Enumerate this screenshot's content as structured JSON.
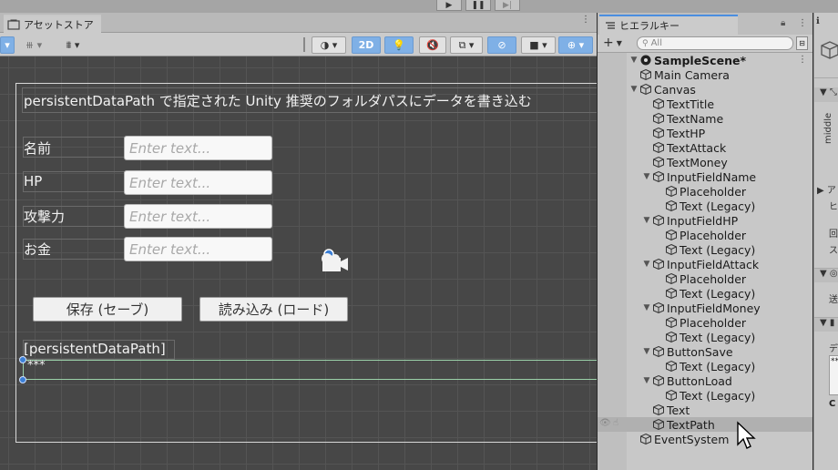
{
  "toolbar_play": {
    "play": "▶",
    "pause": "❚❚",
    "step": "▶|"
  },
  "scene": {
    "tab_label": "アセットストア",
    "toolbar": {
      "mode_2d": "2D"
    }
  },
  "game_ui": {
    "title": "persistentDataPath で指定された Unity 推奨のフォルダパスにデータを書き込む",
    "fields": [
      {
        "label": "名前",
        "placeholder": "Enter text..."
      },
      {
        "label": "HP",
        "placeholder": "Enter text..."
      },
      {
        "label": "攻撃力",
        "placeholder": "Enter text..."
      },
      {
        "label": "お金",
        "placeholder": "Enter text..."
      }
    ],
    "save_button": "保存 (セーブ)",
    "load_button": "読み込み (ロード)",
    "path_label": "[persistentDataPath]",
    "path_value": "***"
  },
  "hierarchy": {
    "tab_label": "ヒエラルキー",
    "search_placeholder": "All",
    "add_label": "+",
    "scene_name": "SampleScene*",
    "items": [
      {
        "name": "Main Camera",
        "depth": 1,
        "expandable": false
      },
      {
        "name": "Canvas",
        "depth": 1,
        "expandable": true
      },
      {
        "name": "TextTitle",
        "depth": 2,
        "expandable": false
      },
      {
        "name": "TextName",
        "depth": 2,
        "expandable": false
      },
      {
        "name": "TextHP",
        "depth": 2,
        "expandable": false
      },
      {
        "name": "TextAttack",
        "depth": 2,
        "expandable": false
      },
      {
        "name": "TextMoney",
        "depth": 2,
        "expandable": false
      },
      {
        "name": "InputFieldName",
        "depth": 2,
        "expandable": true
      },
      {
        "name": "Placeholder",
        "depth": 3,
        "expandable": false
      },
      {
        "name": "Text (Legacy)",
        "depth": 3,
        "expandable": false
      },
      {
        "name": "InputFieldHP",
        "depth": 2,
        "expandable": true
      },
      {
        "name": "Placeholder",
        "depth": 3,
        "expandable": false
      },
      {
        "name": "Text (Legacy)",
        "depth": 3,
        "expandable": false
      },
      {
        "name": "InputFieldAttack",
        "depth": 2,
        "expandable": true
      },
      {
        "name": "Placeholder",
        "depth": 3,
        "expandable": false
      },
      {
        "name": "Text (Legacy)",
        "depth": 3,
        "expandable": false
      },
      {
        "name": "InputFieldMoney",
        "depth": 2,
        "expandable": true
      },
      {
        "name": "Placeholder",
        "depth": 3,
        "expandable": false
      },
      {
        "name": "Text (Legacy)",
        "depth": 3,
        "expandable": false
      },
      {
        "name": "ButtonSave",
        "depth": 2,
        "expandable": true
      },
      {
        "name": "Text (Legacy)",
        "depth": 3,
        "expandable": false
      },
      {
        "name": "ButtonLoad",
        "depth": 2,
        "expandable": true
      },
      {
        "name": "Text (Legacy)",
        "depth": 3,
        "expandable": false
      },
      {
        "name": "Text",
        "depth": 2,
        "expandable": false
      },
      {
        "name": "TextPath",
        "depth": 2,
        "expandable": false,
        "selected": true
      },
      {
        "name": "EventSystem",
        "depth": 1,
        "expandable": false
      }
    ]
  },
  "inspector": {
    "anchor_label": "middle",
    "section_chars": [
      "ア",
      "ヒ",
      "回",
      "ス",
      "送",
      "デ"
    ]
  },
  "colors": {
    "viewport_bg": "#474747",
    "accent_blue": "#7fb0e6",
    "selection": "#b0b0b0"
  }
}
